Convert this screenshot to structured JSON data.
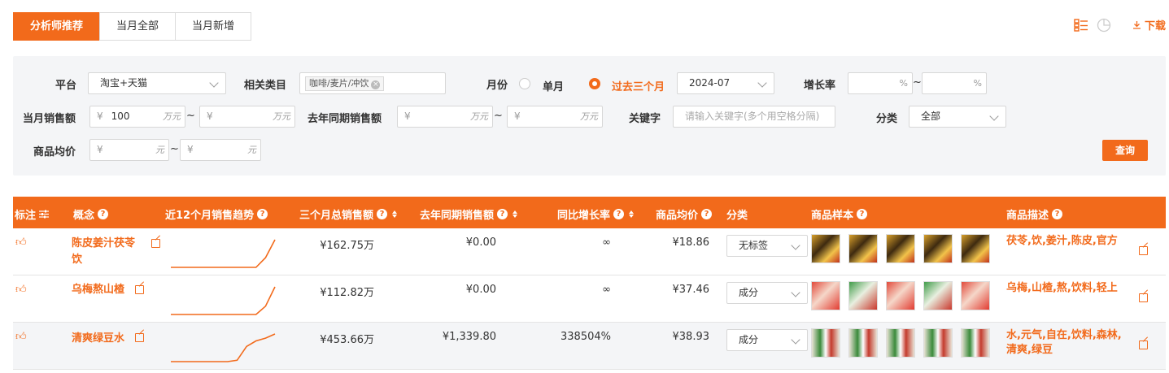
{
  "tabs": [
    "分析师推荐",
    "当月全部",
    "当月新增"
  ],
  "download_label": "下载",
  "filters": {
    "platform_label": "平台",
    "platform_value": "淘宝+天猫",
    "category_label": "相关类目",
    "category_tag": "咖啡/麦片/冲饮",
    "month_label": "月份",
    "single_month": "单月",
    "past_three": "过去三个月",
    "month_value": "2024-07",
    "growth_label": "增长率",
    "pct": "%",
    "tilde": "~",
    "sales_label": "当月销售额",
    "currency": "¥",
    "sales_min": "100",
    "unit_wan": "万元",
    "ly_sales_label": "去年同期销售额",
    "keyword_label": "关键字",
    "keyword_placeholder": "请输入关键字(多个用空格分隔)",
    "class_label": "分类",
    "class_value": "全部",
    "avg_price_label": "商品均价",
    "unit_yuan": "元",
    "query_button": "查询"
  },
  "table": {
    "headers": {
      "mark": "标注",
      "concept": "概念",
      "trend": "近12个月销售趋势",
      "three_month": "三个月总销售额",
      "ly_sales": "去年同期销售额",
      "yoy": "同比增长率",
      "avg_price": "商品均价",
      "category": "分类",
      "samples": "商品样本",
      "description": "商品描述"
    },
    "rows": [
      {
        "concept": "陈皮姜汁茯苓饮",
        "concept_l1": "陈皮姜汁茯苓",
        "concept_l2": "饮",
        "three_month": "¥162.75万",
        "ly_sales": "¥0.00",
        "yoy": "∞",
        "avg_price": "¥18.86",
        "category": "无标签",
        "desc": "茯苓,饮,姜汁,陈皮,官方",
        "trend": [
          0,
          0,
          0,
          0,
          0,
          0,
          0,
          0,
          0,
          0,
          0.35,
          1
        ]
      },
      {
        "concept": "乌梅熬山楂",
        "three_month": "¥112.82万",
        "ly_sales": "¥0.00",
        "yoy": "∞",
        "avg_price": "¥37.46",
        "category": "成分",
        "desc": "乌梅,山楂,熬,饮料,轻上",
        "trend": [
          0,
          0,
          0,
          0,
          0,
          0,
          0,
          0,
          0,
          0,
          0.3,
          1
        ]
      },
      {
        "concept": "清爽绿豆水",
        "three_month": "¥453.66万",
        "ly_sales": "¥1,339.80",
        "yoy": "338504%",
        "avg_price": "¥38.93",
        "category": "成分",
        "desc": "水,元气,自在,饮料,森林,清爽,绿豆",
        "trend": [
          0,
          0,
          0,
          0,
          0,
          0,
          0,
          0.05,
          0.55,
          0.75,
          0.85,
          1
        ]
      }
    ]
  }
}
